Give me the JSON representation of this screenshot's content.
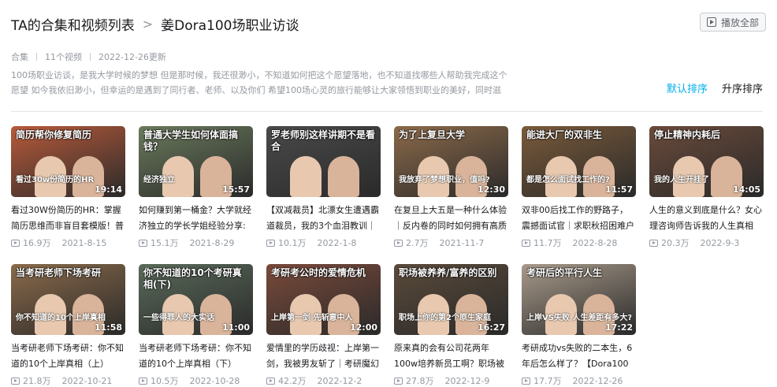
{
  "breadcrumb": {
    "root": "TA的合集和视频列表",
    "sep": ">",
    "current": "姜Dora100场职业访谈"
  },
  "play_all": "播放全部",
  "meta": {
    "type": "合集",
    "count": "11个视频",
    "updated": "2022-12-26更新"
  },
  "description": "100场职业访谈，是我大学时候的梦想 但是那时候，我还很渺小，不知道如何把这个愿望落地，也不知道找哪些人帮助我完成这个愿望 如今我依旧渺小，但幸运的是遇到了同行者、老师、以及你们 希望100场心灵的旅行能够让大家领悟到职业的美好，同时滋养你...",
  "sort": {
    "default": "默认排序",
    "asc": "升序排序"
  },
  "colors": {
    "accent": "#00aeec"
  },
  "videos": [
    {
      "cap": "简历帮你修复简历",
      "sub": "看过30w份简历的HR",
      "dur": "19:14",
      "title": "看过30W份简历的HR：掌握简历思维而非盲目套模版！普",
      "views": "16.9万",
      "date": "2021-8-15",
      "bg": "#b85a3a"
    },
    {
      "cap": "普通大学生如何体面搞钱？",
      "sub": "经济独立",
      "dur": "15:57",
      "title": "如何赚到第一桶金？大学就经济独立的学长学姐经验分享:",
      "views": "15.1万",
      "date": "2021-8-29",
      "bg": "#6a7a5c"
    },
    {
      "cap": "罗老师别这样讲期不是看合",
      "sub": "",
      "dur": "",
      "title": "【双减裁员】北漂女生遭遇霸道裁员，我的3个血泪教训｜",
      "views": "10.1万",
      "date": "2022-1-8",
      "bg": "#4a4a4a"
    },
    {
      "cap": "为了上复旦大学",
      "sub": "我放弃了梦想职业，值吗?",
      "dur": "12:30",
      "title": "在复旦上大五是一种什么体验｜反内卷的同时如何拥有高质",
      "views": "2.7万",
      "date": "2021-11-7",
      "bg": "#8c6a4a"
    },
    {
      "cap": "能进大厂的双非生",
      "sub": "都是怎么面试找工作的?",
      "dur": "11:57",
      "title": "双非00后找工作的野路子，震撼面试官｜求职秋招困难户出",
      "views": "11.7万",
      "date": "2022-8-28",
      "bg": "#7a5a3a"
    },
    {
      "cap": "停止精神内耗后",
      "sub": "我的人生开挂了",
      "dur": "14:05",
      "title": "人生的意义到底是什么？女心理咨询师告诉我的人生真相",
      "views": "20.3万",
      "date": "2022-9-3",
      "bg": "#6a4a3a"
    },
    {
      "cap": "当考研老师下场考研",
      "sub": "你不知道的10个上岸真相",
      "dur": "11:58",
      "title": "当考研老师下场考研：你不知道的10个上岸真相（上）",
      "views": "21.8万",
      "date": "2022-10-21",
      "bg": "#8a6a4a"
    },
    {
      "cap": "你不知道的10个考研真相(下)",
      "sub": "一些得罪人的大实话",
      "dur": "11:00",
      "title": "当考研老师下场考研：你不知道的10个上岸真相（下）",
      "views": "10.5万",
      "date": "2022-10-28",
      "bg": "#5a6a5a"
    },
    {
      "cap": "考研考公时的爱情危机",
      "sub": "上岸第一剑 先斩意中人",
      "dur": "12:00",
      "title": "爱情里的学历歧视：上岸第一剑，我被男友斩了｜考研魔幻",
      "views": "42.2万",
      "date": "2022-12-2",
      "bg": "#7a4a3a"
    },
    {
      "cap": "职场被养养/富养的区别",
      "sub": "职场上你的第2个原生家庭",
      "dur": "16:27",
      "title": "原来真的会有公司花两年100w培养新员工啊？职场被",
      "views": "27.8万",
      "date": "2022-12-9",
      "bg": "#5a4a3a"
    },
    {
      "cap": "考研后的平行人生",
      "sub": "上岸VS失败 人生差距有多大?",
      "dur": "17:22",
      "title": "考研成功vs失败的二本生，6年后怎么样了？【Dora100场",
      "views": "17.7万",
      "date": "2022-12-26",
      "bg": "#a89a8a"
    }
  ]
}
